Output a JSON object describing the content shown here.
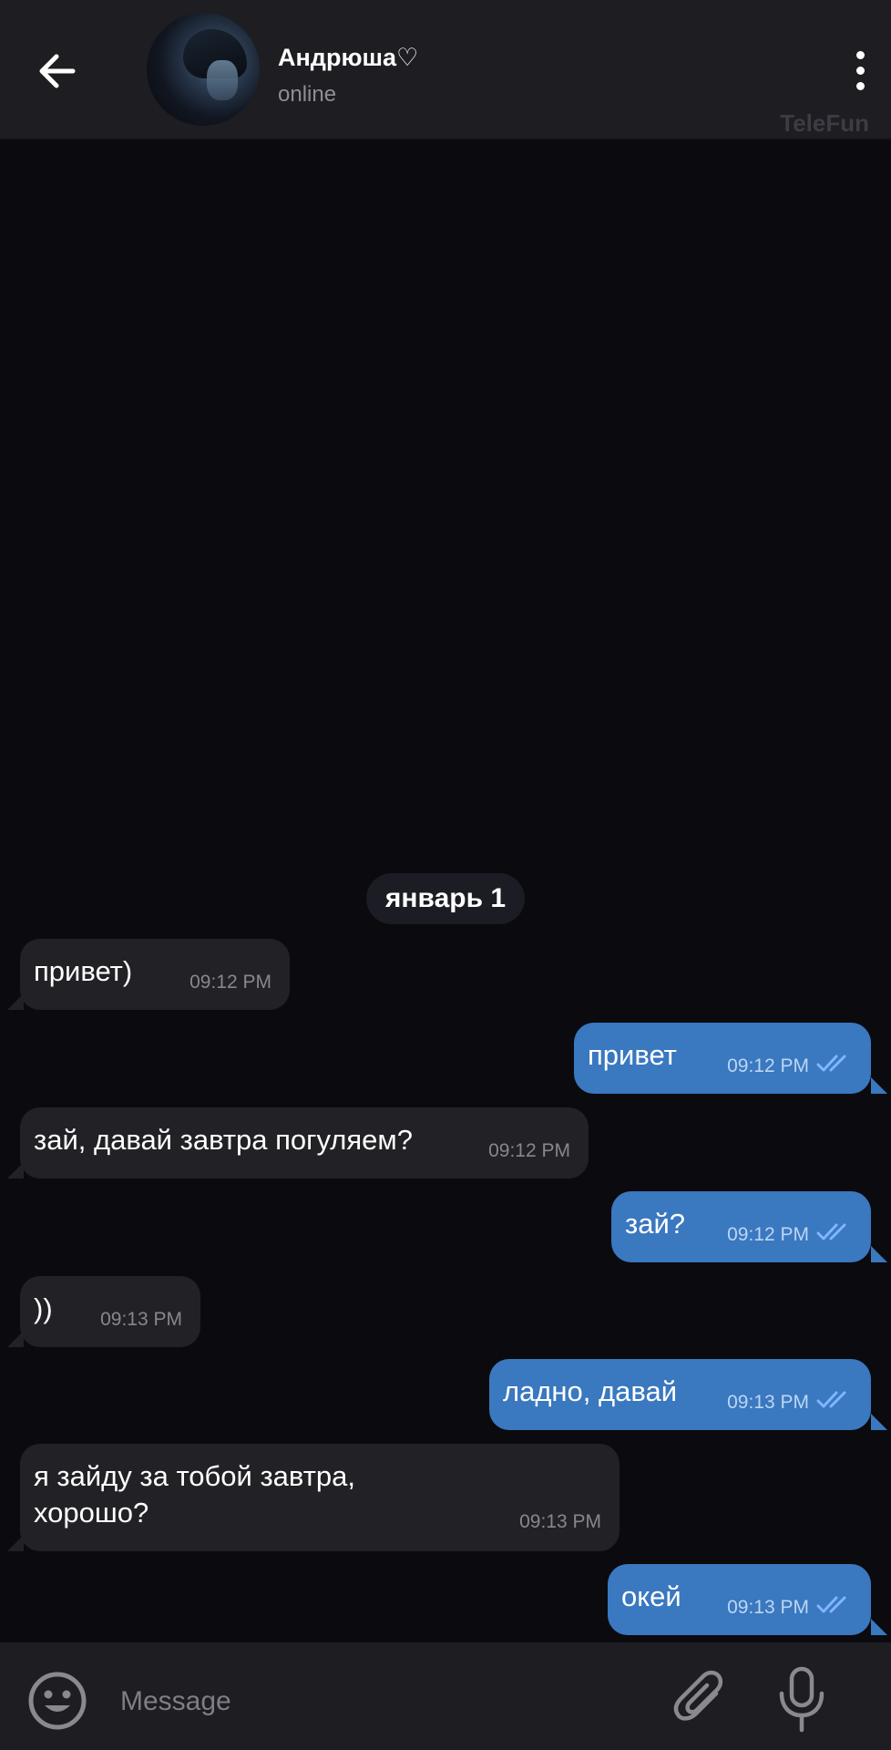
{
  "header": {
    "contact_name": "Андрюша♡",
    "status": "online",
    "watermark": "TeleFun"
  },
  "chat": {
    "date_separator": "январь 1",
    "messages": [
      {
        "direction": "in",
        "text": "привет)",
        "time": "09:12 PM"
      },
      {
        "direction": "out",
        "text": "привет",
        "time": "09:12 PM",
        "read": true
      },
      {
        "direction": "in",
        "text": "зай, давай завтра погуляем?",
        "time": "09:12 PM"
      },
      {
        "direction": "out",
        "text": "зай?",
        "time": "09:12 PM",
        "read": true
      },
      {
        "direction": "in",
        "text": "))",
        "time": "09:13 PM"
      },
      {
        "direction": "out",
        "text": "ладно, давай",
        "time": "09:13 PM",
        "read": true
      },
      {
        "direction": "in",
        "text_lines": [
          "я зайду за тобой завтра,",
          "хорошо?"
        ],
        "time": "09:13 PM"
      },
      {
        "direction": "out",
        "text": "окей",
        "time": "09:13 PM",
        "read": true
      }
    ]
  },
  "composer": {
    "placeholder": "Message"
  },
  "icons": {
    "back": "arrow-left-icon",
    "menu": "more-vertical-icon",
    "emoji": "emoji-icon",
    "attach": "paperclip-icon",
    "mic": "microphone-icon",
    "read_receipt": "double-check-icon"
  },
  "colors": {
    "background": "#0b0a0e",
    "bar": "#1e1d22",
    "incoming_bubble": "#222126",
    "outgoing_bubble": "#3a78c0",
    "read_check": "#7fb6ff"
  }
}
